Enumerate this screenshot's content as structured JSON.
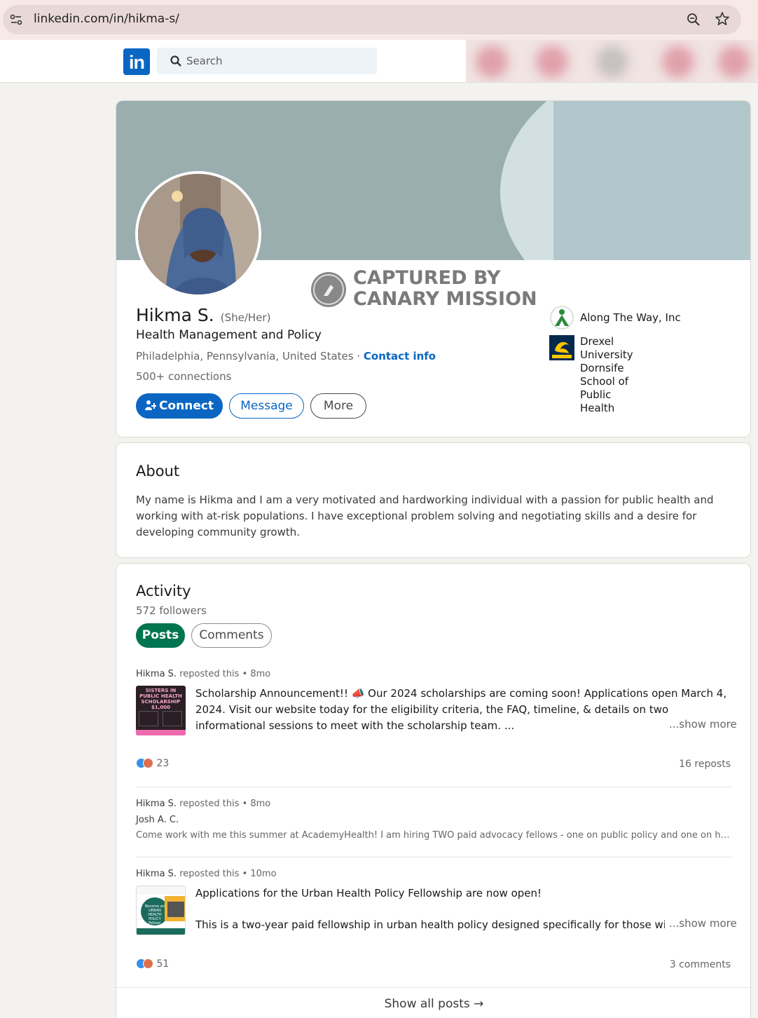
{
  "browser": {
    "url": "linkedin.com/in/hikma-s/"
  },
  "nav": {
    "logo_text": "in",
    "search_placeholder": "Search"
  },
  "profile": {
    "name": "Hikma S.",
    "pronouns": "(She/Her)",
    "headline": "Health Management and Policy",
    "location": "Philadelphia, Pennsylvania, United States",
    "separator": " · ",
    "contact_label": "Contact info",
    "connections": "500+ connections",
    "connect_label": "Connect",
    "message_label": "Message",
    "more_label": "More",
    "experience": [
      {
        "name": "Along The Way, Inc"
      },
      {
        "name": "Drexel University Dornsife\nSchool of Public Health"
      }
    ],
    "watermark": "CAPTURED BY\nCANARY MISSION"
  },
  "about": {
    "title": "About",
    "text": "My name is Hikma and I am a very motivated and hardworking individual with a passion for public health and working with at-risk populations. I have exceptional problem solving and negotiating skills and a desire for developing community growth."
  },
  "activity": {
    "title": "Activity",
    "followers": "572 followers",
    "tabs": {
      "posts": "Posts",
      "comments": "Comments"
    },
    "posts": [
      {
        "author": "Hikma S.",
        "meta": "reposted this • 8mo",
        "thumb_text": "SISTERS IN PUBLIC HEALTH SCHOLARSHIP $1,000",
        "text": "Scholarship Announcement!! 📣 Our 2024 scholarships are coming soon! Applications open March 4, 2024. Visit our website today for the eligibility criteria, the FAQ, timeline, & details on two informational sessions to meet with the scholarship team. ...",
        "show_more": "...show more",
        "reaction_count": "23",
        "right_stat": "16 reposts"
      },
      {
        "author": "Hikma S.",
        "meta": "reposted this • 8mo",
        "original_author": "Josh A. C.",
        "text": "Come work with me this summer at AcademyHealth! I am hiring TWO paid advocacy fellows - one on public policy and one on health data p..."
      },
      {
        "author": "Hikma S.",
        "meta": "reposted this • 10mo",
        "thumb_text": "Become an URBAN HEALTH POLICY Fellow!",
        "text": "Applications for the Urban Health Policy Fellowship are now open!",
        "text2": "This is a two-year paid fellowship in urban health policy designed specifically for those with bacc",
        "show_more": "...show more",
        "reaction_count": "51",
        "right_stat": "3 comments"
      }
    ],
    "show_all": "Show all posts →"
  },
  "colors": {
    "linkedin_blue": "#0a66c2",
    "posts_green": "#01754f",
    "cover": "#9aaeb0"
  }
}
